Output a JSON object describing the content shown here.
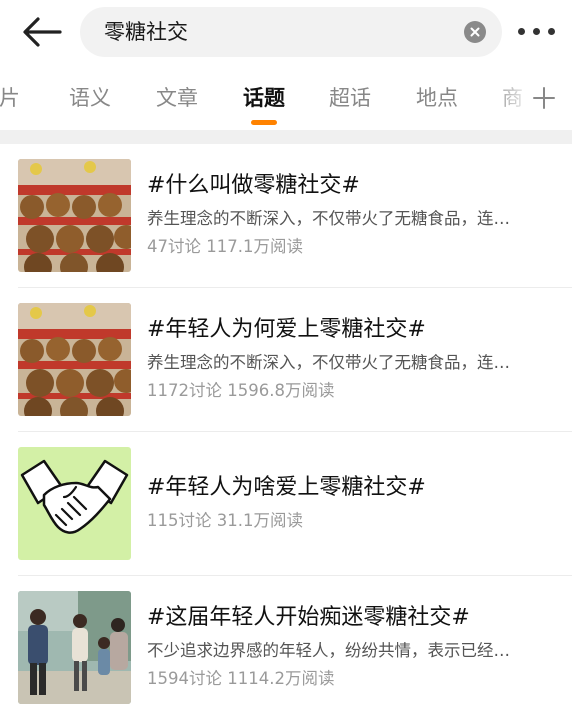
{
  "search": {
    "query": "零糖社交"
  },
  "icons": {
    "back": "back-arrow-icon",
    "clear": "clear-icon",
    "more": "more-dots-icon",
    "add_tab": "plus-icon"
  },
  "colors": {
    "accent": "#ff8200",
    "active_tab": "#111111",
    "inactive_tab": "#888888"
  },
  "tabs": [
    {
      "label": "图片",
      "active": false
    },
    {
      "label": "语义",
      "active": false
    },
    {
      "label": "文章",
      "active": false
    },
    {
      "label": "话题",
      "active": true
    },
    {
      "label": "超话",
      "active": false
    },
    {
      "label": "地点",
      "active": false
    },
    {
      "label": "商",
      "active": false
    }
  ],
  "topics": [
    {
      "title": "#什么叫做零糖社交#",
      "desc": "养生理念的不断深入，不仅带火了无糖食品，连…",
      "stats": "47讨论 117.1万阅读"
    },
    {
      "title": "#年轻人为何爱上零糖社交#",
      "desc": "养生理念的不断深入，不仅带火了无糖食品，连…",
      "stats": "1172讨论 1596.8万阅读"
    },
    {
      "title": "#年轻人为啥爱上零糖社交#",
      "desc": "",
      "stats": "115讨论 31.1万阅读"
    },
    {
      "title": "#这届年轻人开始痴迷零糖社交#",
      "desc": "不少追求边界感的年轻人，纷纷共情，表示已经…",
      "stats": "1594讨论 1114.2万阅读"
    }
  ]
}
